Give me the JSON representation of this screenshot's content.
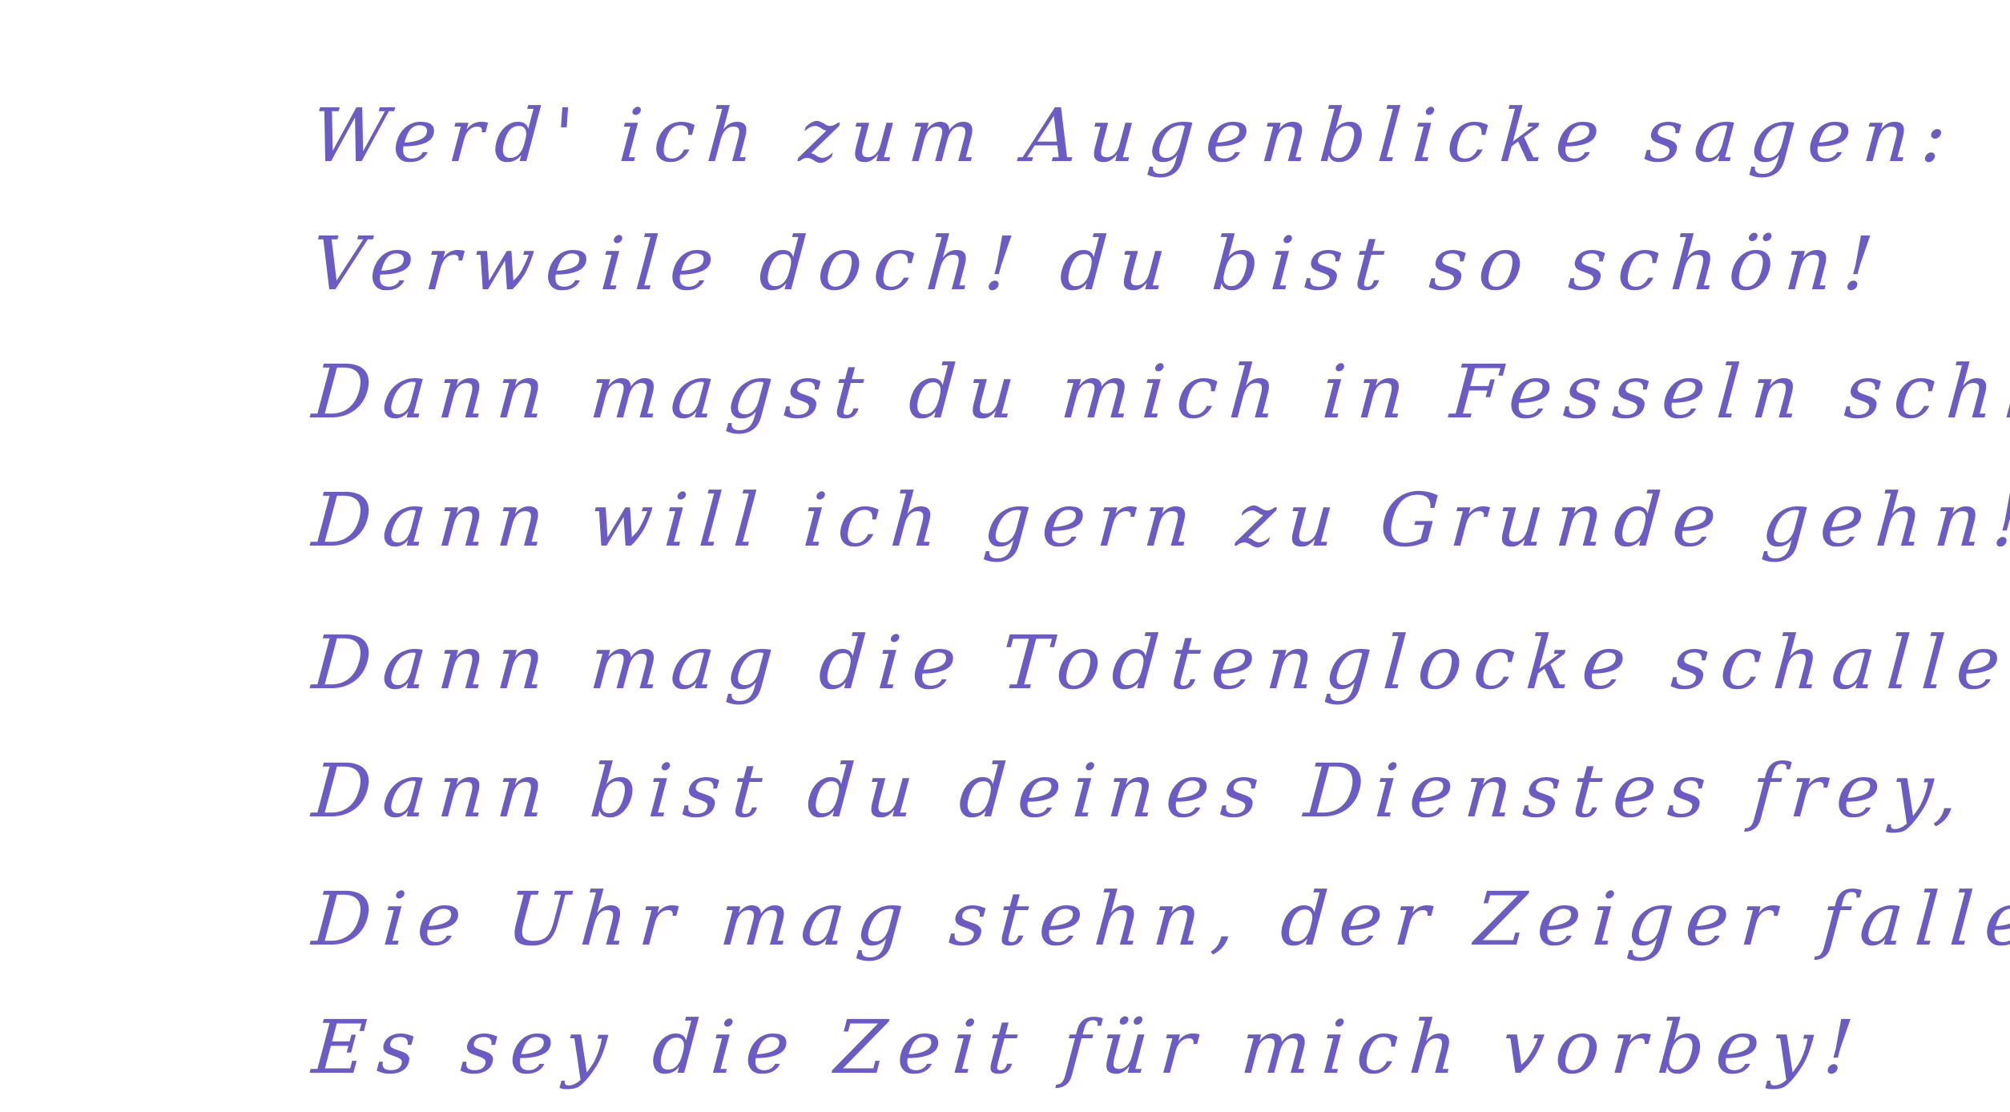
{
  "poem": {
    "lines": [
      "Werd' ich zum Augenblicke sagen:",
      "Verweile doch! du bist so schön!",
      "Dann magst du mich in Fesseln schlagen,",
      "Dann will ich gern zu Grunde gehn!",
      "Dann mag die Todtenglocke schallen,",
      "Dann bist du deines Dienstes frey,",
      "Die Uhr mag stehn, der Zeiger fallen,",
      "Es sey die Zeit für mich vorbey!"
    ]
  },
  "colors": {
    "ink": "#6a5cc4",
    "paper": "#ffffff"
  }
}
